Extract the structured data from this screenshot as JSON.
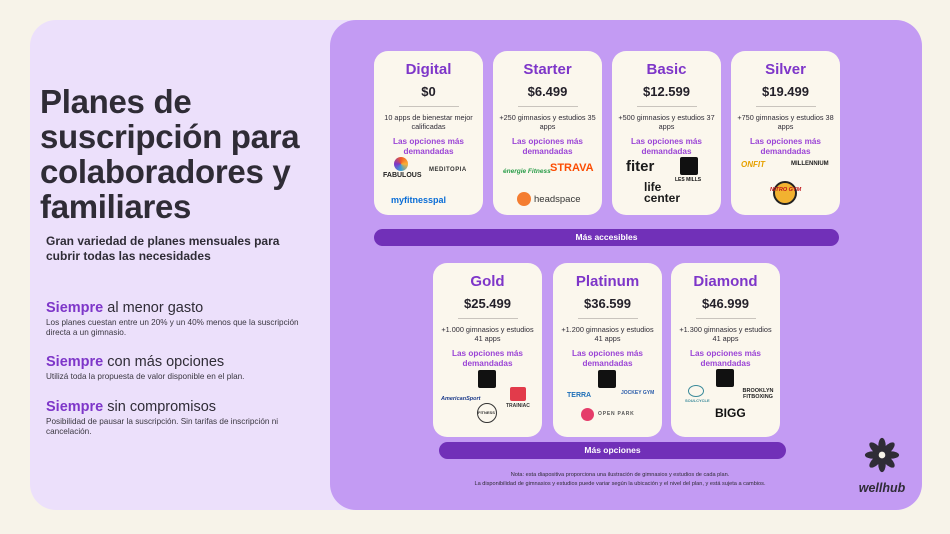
{
  "title": "Planes de suscripción para colaboradores y familiares",
  "subtitle": "Gran variedad de planes mensuales para cubrir todas las necesidades",
  "benefits": [
    {
      "bold": "Siempre",
      "rest": " al menor gasto",
      "desc": "Los planes cuestan entre un 20% y un 40% menos que la suscripción directa a un gimnasio."
    },
    {
      "bold": "Siempre",
      "rest": " con más opciones",
      "desc": "Utilizá toda la propuesta de valor disponible en el plan."
    },
    {
      "bold": "Siempre",
      "rest": " sin compromisos",
      "desc": "Posibilidad de pausar la suscripción. Sin tarifas de inscripción ni cancelación."
    }
  ],
  "plans": [
    {
      "name": "Digital",
      "price": "$0",
      "desc": "10 apps de bienestar mejor calificadas",
      "options": "Las opciones más demandadas",
      "logos": [
        "FABULOUS",
        "MEDITOPIA",
        "myfitnesspal"
      ]
    },
    {
      "name": "Starter",
      "price": "$6.499",
      "desc": "+250 gimnasios y estudios 35 apps",
      "options": "Las opciones más demandadas",
      "logos": [
        "énergie Fitness",
        "STRAVA",
        "headspace"
      ]
    },
    {
      "name": "Basic",
      "price": "$12.599",
      "desc": "+500 gimnasios y estudios 37 apps",
      "options": "Las opciones más demandadas",
      "logos": [
        "fiter",
        "LES MILLS",
        "life center"
      ]
    },
    {
      "name": "Silver",
      "price": "$19.499",
      "desc": "+750 gimnasios y estudios 38 apps",
      "options": "Las opciones más demandadas",
      "logos": [
        "ONFIT",
        "MILLENNIUM",
        "NITRO GYM"
      ]
    },
    {
      "name": "Gold",
      "price": "$25.499",
      "desc": "+1.000 gimnasios y estudios 41 apps",
      "options": "Las opciones más demandadas",
      "logos": [
        "AmericanSport",
        "TRAINIAC",
        "FITNESS"
      ]
    },
    {
      "name": "Platinum",
      "price": "$36.599",
      "desc": "+1.200 gimnasios y estudios 41 apps",
      "options": "Las opciones más demandadas",
      "logos": [
        "TERRA",
        "JOCKEY GYM",
        "OPEN PARK"
      ]
    },
    {
      "name": "Diamond",
      "price": "$46.999",
      "desc": "+1.300 gimnasios y estudios 41 apps",
      "options": "Las opciones más demandadas",
      "logos": [
        "SOULCYCLE",
        "BROOKLYN FITBOXING",
        "BIGG"
      ]
    }
  ],
  "bars": {
    "top": "Más accesibles",
    "bottom": "Más opciones"
  },
  "notes": [
    "Nota: esta diapositiva proporciona una ilustración de gimnasios y estudios de cada plan.",
    "La disponibilidad de gimnasios y estudios puede variar según la ubicación y el nivel del plan, y está sujeta a cambios."
  ],
  "brand": {
    "name": "wellhub",
    "icon": "wellhub-flower-icon"
  },
  "colors": {
    "accent": "#7e36c9",
    "bar": "#7130b8",
    "panel": "#c39bf3",
    "panel_light": "#ece0fb",
    "card": "#fbf7ed",
    "background": "#f7f3e9"
  }
}
